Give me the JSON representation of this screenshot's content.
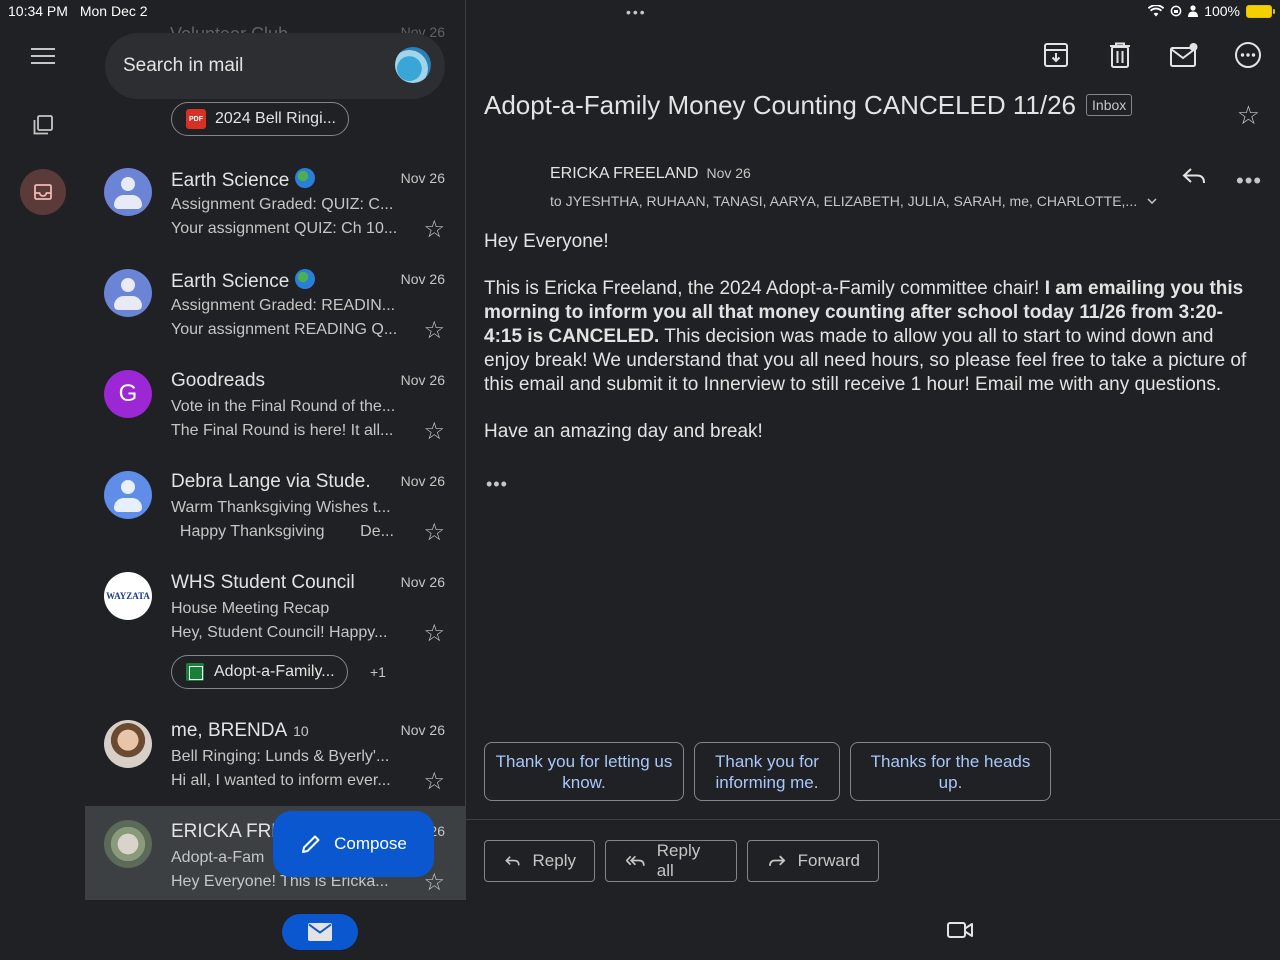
{
  "status": {
    "time": "10:34 PM",
    "date": "Mon Dec 2",
    "battery": "100%"
  },
  "search": {
    "placeholder": "Search in mail"
  },
  "ghost_row": {
    "sender": "Volunteer Club",
    "date": "Nov 26"
  },
  "chips": {
    "pdf": "2024 Bell Ringi...",
    "sheet": "Adopt-a-Family...",
    "sheet_extra": "+1"
  },
  "mails": [
    {
      "sender": "Earth Science",
      "date": "Nov 26",
      "subject": "Assignment Graded: QUIZ:  C...",
      "snippet": "Your assignment QUIZ: Ch 10..."
    },
    {
      "sender": "Earth Science",
      "date": "Nov 26",
      "subject": "Assignment Graded: READIN...",
      "snippet": "Your assignment READING Q..."
    },
    {
      "sender": "Goodreads",
      "avatar_letter": "G",
      "date": "Nov 26",
      "subject": "Vote in the Final Round of the...",
      "snippet": "The Final Round is here! It all..."
    },
    {
      "sender": "Debra Lange via Stude.",
      "date": "Nov 26",
      "subject": "Warm Thanksgiving Wishes t...",
      "snippet": "  Happy Thanksgiving        De..."
    },
    {
      "sender": "WHS Student Council",
      "avatar_text": "WAYZATA",
      "date": "Nov 26",
      "subject": "House Meeting Recap",
      "snippet": "Hey, Student Council! Happy..."
    },
    {
      "sender": "me, BRENDA",
      "count": "10",
      "date": "Nov 26",
      "subject": "Bell Ringing: Lunds & Byerly'...",
      "snippet": "Hi all, I wanted to inform ever..."
    },
    {
      "sender": "ERICKA FRE",
      "date": "26",
      "subject": "Adopt-a-Fam",
      "snippet": "Hey Everyone! This is Ericka..."
    }
  ],
  "compose_label": "Compose",
  "email": {
    "subject": "Adopt-a-Family Money Counting CANCELED 11/26",
    "label": "Inbox",
    "from": "ERICKA FREELAND",
    "from_date": "Nov 26",
    "to": "to JYESHTHA, RUHAAN, TANASI, AARYA, ELIZABETH, JULIA, SARAH, me, CHARLOTTE,...",
    "greeting": "Hey Everyone!",
    "para_start": "This is Ericka Freeland, the 2024 Adopt-a-Family committee chair! ",
    "para_bold": "I am emailing you this morning to inform you all that money counting after school today 11/26 from 3:20-4:15 is CANCELED.",
    "para_end": " This decision was made to allow you all to start to wind down and enjoy break! We understand that you all need hours, so please feel free to take a picture of this email and submit it to Innerview to still receive 1 hour! Email me with any questions.",
    "closing": "Have an amazing day and break!",
    "trimmed": "•••"
  },
  "smart_replies": [
    "Thank you for letting us know.",
    "Thank you for informing me.",
    "Thanks for the heads up."
  ],
  "actions": {
    "reply": "Reply",
    "reply_all": "Reply all",
    "forward": "Forward"
  }
}
